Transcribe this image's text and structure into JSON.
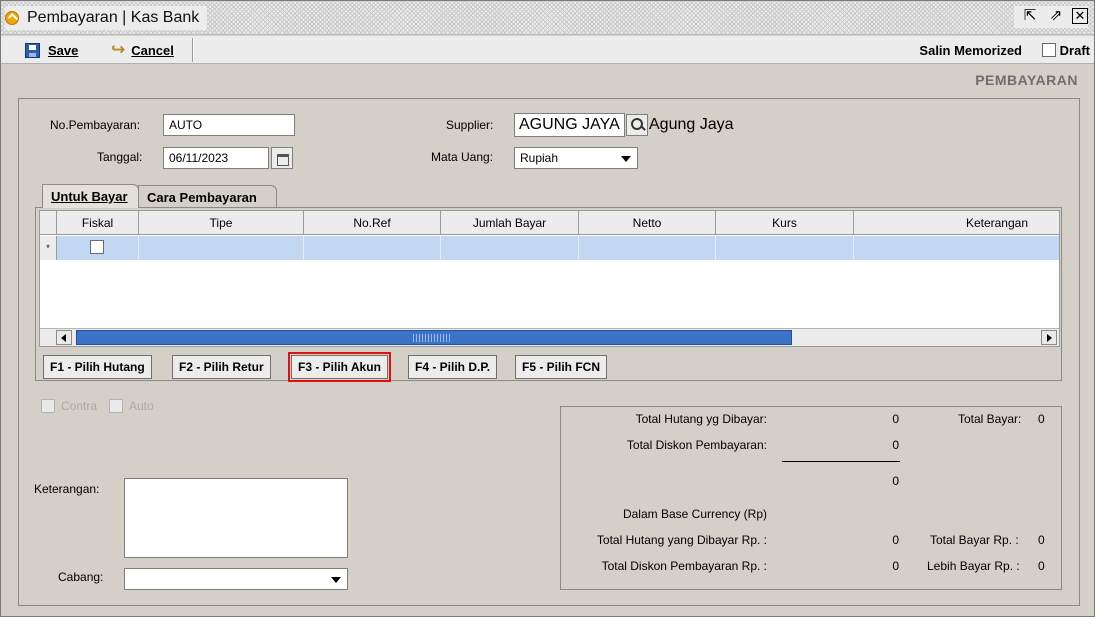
{
  "window": {
    "title": "Pembayaran | Kas Bank",
    "buttons": {
      "restore": "⇱",
      "maximize": "⇗",
      "close": "✕"
    }
  },
  "toolbar": {
    "save_label": "Save",
    "save_mnemonic": "S",
    "cancel_label": "Cancel",
    "cancel_mnemonic": "C",
    "salin_memorized_label": "Salin Memorized",
    "draft_label": "Draft",
    "draft_checked": false
  },
  "page_heading": "PEMBAYARAN",
  "form": {
    "no_pembayaran_label": "No.Pembayaran:",
    "no_pembayaran_value": "AUTO",
    "tanggal_label": "Tanggal:",
    "tanggal_value": "06/11/2023",
    "supplier_label": "Supplier:",
    "supplier_code": "AGUNG JAYA",
    "supplier_name": "Agung Jaya",
    "mata_uang_label": "Mata Uang:",
    "mata_uang_value": "Rupiah"
  },
  "tabs": [
    {
      "label": "Untuk Bayar",
      "active": true
    },
    {
      "label": "Cara Pembayaran",
      "active": false
    }
  ],
  "grid": {
    "columns": [
      "Fiskal",
      "Tipe",
      "No.Ref",
      "Jumlah Bayar",
      "Netto",
      "Kurs",
      "Keterangan"
    ],
    "new_row_marker": "*"
  },
  "function_buttons": [
    "F1 - Pilih Hutang",
    "F2 - Pilih Retur",
    "F3 - Pilih Akun",
    "F4 - Pilih D.P.",
    "F5 - Pilih FCN"
  ],
  "options": {
    "contra_label": "Contra",
    "auto_label": "Auto"
  },
  "bottom": {
    "keterangan_label": "Keterangan:",
    "cabang_label": "Cabang:",
    "cabang_value": ""
  },
  "totals": {
    "total_hutang_label": "Total Hutang yg Dibayar:",
    "total_hutang_value": "0",
    "total_bayar_label": "Total Bayar:",
    "total_bayar_value": "0",
    "total_diskon_label": "Total Diskon Pembayaran:",
    "total_diskon_value": "0",
    "subtotal_value": "0",
    "base_currency_label": "Dalam Base Currency (Rp)",
    "total_hutang_rp_label": "Total Hutang yang Dibayar Rp. :",
    "total_hutang_rp_value": "0",
    "total_bayar_rp_label": "Total Bayar Rp. :",
    "total_bayar_rp_value": "0",
    "total_diskon_rp_label": "Total Diskon Pembayaran Rp. :",
    "total_diskon_rp_value": "0",
    "lebih_bayar_rp_label": "Lebih Bayar Rp. :",
    "lebih_bayar_rp_value": "0"
  },
  "colors": {
    "highlight_outline": "#e01010",
    "selected_row": "#c2d8f2",
    "scroll_thumb": "#3d72c9"
  }
}
